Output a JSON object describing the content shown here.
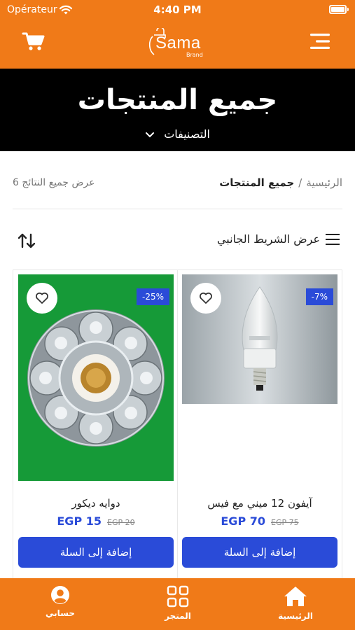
{
  "status_bar": {
    "carrier": "Opérateur",
    "time": "4:40 PM"
  },
  "header": {
    "logo_text": "Sama",
    "logo_sub": "Brand"
  },
  "banner": {
    "title": "جميع المنتجات",
    "categories_label": "التصنيفات"
  },
  "breadcrumb": {
    "home": "الرئيسية",
    "separator": "/",
    "current": "جميع المنتجات"
  },
  "results_text": "عرض جميع النتائج 6",
  "sidebar_toggle_label": "عرض الشريط الجانبي",
  "products": [
    {
      "name": "آيفون 12 ميني مع فيس",
      "price": "EGP 70",
      "old_price": "EGP 75",
      "discount": "-7%",
      "add_label": "إضافة إلى السلة",
      "image": "led-candle-bulb"
    },
    {
      "name": "دوايه ديكور",
      "price": "EGP 15",
      "old_price": "EGP 20",
      "discount": "-25%",
      "add_label": "إضافة إلى السلة",
      "image": "decorative-lamp-holder"
    }
  ],
  "bottom_nav": {
    "home": "الرئيسية",
    "store": "المتجر",
    "account": "حسابي"
  },
  "colors": {
    "brand_orange": "#f07a18",
    "accent_blue": "#2a4bd8",
    "banner_bg": "#000000"
  }
}
